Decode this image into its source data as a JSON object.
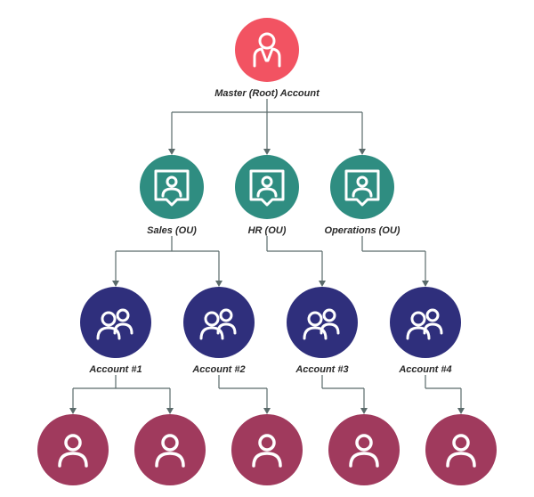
{
  "root": {
    "label": "Master (Root) Account",
    "color": "#f25362"
  },
  "ous": [
    {
      "label": "Sales (OU)",
      "color": "#2f8d81"
    },
    {
      "label": "HR (OU)",
      "color": "#2f8d81"
    },
    {
      "label": "Operations (OU)",
      "color": "#2f8d81"
    }
  ],
  "accounts": [
    {
      "label": "Account #1",
      "color": "#2f2f7c"
    },
    {
      "label": "Account #2",
      "color": "#2f2f7c"
    },
    {
      "label": "Account #3",
      "color": "#2f2f7c"
    },
    {
      "label": "Account #4",
      "color": "#2f2f7c"
    }
  ],
  "user_color": "#a03a5d",
  "connector_color": "#5a6a6a",
  "edges_root_to_ou": [
    [
      0
    ],
    [
      1
    ],
    [
      2
    ]
  ],
  "edges_ou_to_account": {
    "0": [
      0,
      1
    ],
    "1": [
      2
    ],
    "2": [
      3
    ]
  },
  "edges_account_to_user": {
    "0": [
      0,
      1
    ],
    "1": [
      2
    ],
    "2": [
      3
    ],
    "3": [
      4
    ]
  }
}
